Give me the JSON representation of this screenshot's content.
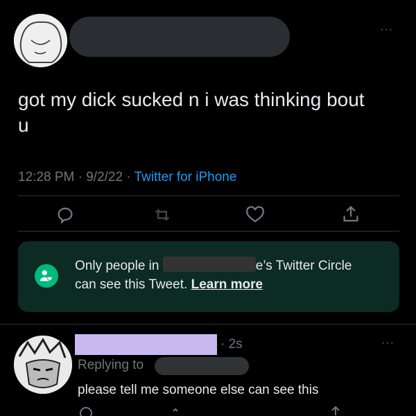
{
  "tweet": {
    "text": "got my dick sucked n i was thinking bout u",
    "time": "12:28 PM",
    "dot1": "·",
    "date": "9/2/22",
    "dot2": "·",
    "source": "Twitter for iPhone",
    "more": "···"
  },
  "circle_notice": {
    "prefix": "Only people in",
    "suffix": "e’s Twitter Circle",
    "line2": "can see this Tweet.",
    "learn_more": "Learn more",
    "accent": "#00ba7c"
  },
  "reply": {
    "time": "· 2s",
    "replying_to": "Replying to",
    "text": "please tell me someone else can see this",
    "more": "···",
    "name_highlight": "#c8b8f0"
  },
  "icons": [
    "reply-icon",
    "retweet-icon",
    "like-icon",
    "share-icon",
    "circle-people-icon"
  ]
}
